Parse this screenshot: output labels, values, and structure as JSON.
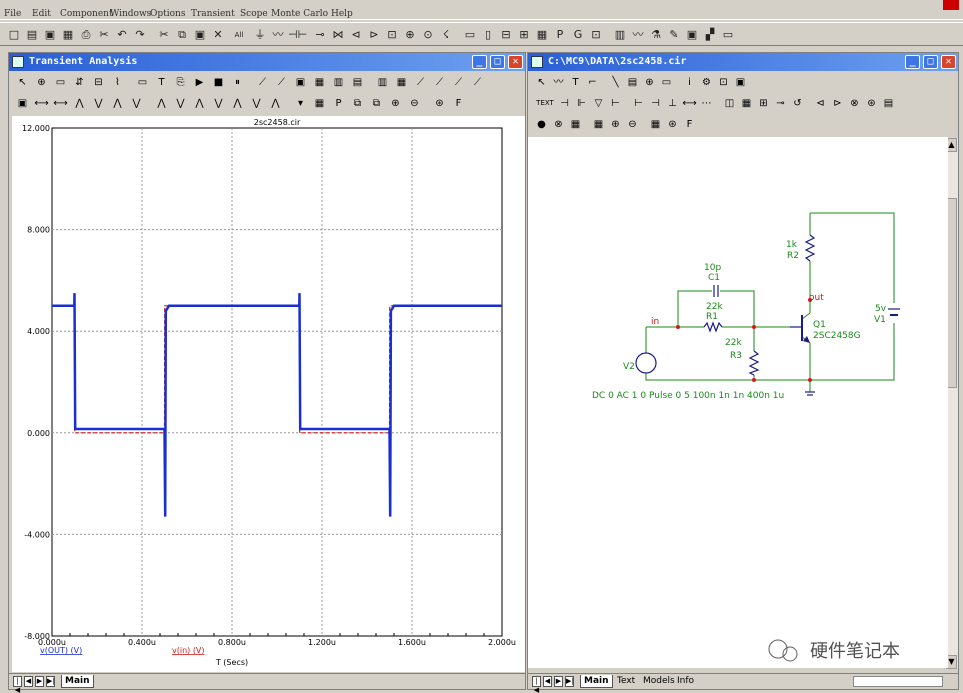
{
  "menu": [
    "File",
    "Edit",
    "Component",
    "Windows",
    "Options",
    "Transient",
    "Scope",
    "Monte Carlo",
    "Help"
  ],
  "toolbar_glyphs": [
    "□",
    "▤",
    "▣",
    "▦",
    "⎙",
    "✂",
    "↶",
    "↷",
    "✂",
    "⧉",
    "▣",
    "✕",
    "All",
    "⏚",
    "〰",
    "⊣⊢",
    "⊸",
    "⋈",
    "⊲",
    "⊳",
    "⊡",
    "⊕",
    "⊙",
    "☇",
    "▭",
    "▯",
    "⊟",
    "⊞",
    "▦",
    "P",
    "G",
    "⊡",
    "▥",
    "〰",
    "⚗",
    "✎",
    "▣",
    "▞",
    "▭"
  ],
  "transient": {
    "title": "Transient Analysis",
    "row1": [
      "↖",
      "⊕",
      "▭",
      "⇵",
      "⊟",
      "⌇",
      "▭",
      "T",
      "⎘",
      "▶",
      "■",
      "⏸",
      "⟋",
      "⟋",
      "▣",
      "▦",
      "▥",
      "▤",
      "▥",
      "▦",
      "⟋",
      "⟋",
      "⟋",
      "⟋"
    ],
    "row2": [
      "▣",
      "⟷",
      "⟷",
      "⋀",
      "⋁",
      "⋀",
      "⋁",
      "⋀",
      "⋁",
      "⋀",
      "⋁",
      "⋀",
      "⋁",
      "⋀",
      "▾",
      "▦",
      "P",
      "⧉",
      "⧉",
      "⊕",
      "⊖",
      "⊛",
      "F"
    ],
    "tab": "Main"
  },
  "schematic": {
    "title": "C:\\MC9\\DATA\\2sc2458.cir",
    "row1": [
      "↖",
      "〰",
      "T",
      "⌐",
      "╲",
      "▤",
      "⊕",
      "▭",
      "i",
      "⚙",
      "⊡",
      "▣"
    ],
    "row2": [
      "TEXT",
      "⊣",
      "⊩",
      "▽",
      "⊢",
      "⊢",
      "⊣",
      "⊥",
      "⟷",
      "⋯",
      "◫",
      "▦",
      "⊞",
      "⊸",
      "↺",
      "⊲",
      "⊳",
      "⊗",
      "⊛",
      "▤"
    ],
    "row3": [
      "●",
      "⊗",
      "▦",
      "▦",
      "⊕",
      "⊖",
      "▦",
      "⊛",
      "F"
    ],
    "tabs": [
      "Main",
      "Text",
      "Models",
      "Info"
    ]
  },
  "chart_data": {
    "type": "line",
    "title": "2sc2458.cir",
    "xlabel": "T (Secs)",
    "xlim": [
      0,
      2e-06
    ],
    "ylim": [
      -8,
      12
    ],
    "x_ticks": [
      "0.000u",
      "0.400u",
      "0.800u",
      "1.200u",
      "1.600u",
      "2.000u"
    ],
    "y_ticks": [
      "12.000",
      "8.000",
      "4.000",
      "0.000",
      "-4.000",
      "-8.000"
    ],
    "grid": true,
    "series": [
      {
        "name": "v(OUT) (V)",
        "color": "#1a2fd0",
        "points": [
          [
            0,
            5
          ],
          [
            9.9e-08,
            5
          ],
          [
            1e-07,
            5.5
          ],
          [
            1.03e-07,
            0.15
          ],
          [
            5e-07,
            0.15
          ],
          [
            5.03e-07,
            -3.3
          ],
          [
            5.06e-07,
            4.8
          ],
          [
            5.2e-07,
            5
          ],
          [
            1.099e-06,
            5
          ],
          [
            1.1e-06,
            5.5
          ],
          [
            1.103e-06,
            0.15
          ],
          [
            1.5e-06,
            0.15
          ],
          [
            1.503e-06,
            -3.3
          ],
          [
            1.506e-06,
            4.8
          ],
          [
            1.52e-06,
            5
          ],
          [
            2e-06,
            5
          ]
        ]
      },
      {
        "name": "v(in) (V)",
        "color": "#d01a1a",
        "points": [
          [
            0,
            5
          ],
          [
            1e-07,
            5
          ],
          [
            1.01e-07,
            0
          ],
          [
            5e-07,
            0
          ],
          [
            5.01e-07,
            5
          ],
          [
            1.1e-06,
            5
          ],
          [
            1.101e-06,
            0
          ],
          [
            1.5e-06,
            0
          ],
          [
            1.501e-06,
            5
          ],
          [
            2e-06,
            5
          ]
        ]
      }
    ]
  },
  "circuit": {
    "C1_value": "10p",
    "C1_name": "C1",
    "R1_value": "22k",
    "R1_name": "R1",
    "R3_value": "22k",
    "R3_name": "R3",
    "R2_value": "1k",
    "R2_name": "R2",
    "Q1_name": "Q1",
    "Q1_model": "2SC2458G",
    "V1_value": "5v",
    "V1_name": "V1",
    "V2_name": "V2",
    "node_in": "in",
    "node_out": "out",
    "V2_spec": "DC 0 AC 1 0 Pulse 0 5 100n 1n 1n 400n 1u",
    "colors": {
      "wire": "#1a8a1a",
      "label": "#1a8a1a",
      "part": "#1a1a8a",
      "node": "#d01a1a"
    }
  },
  "watermark": "硬件笔记本"
}
